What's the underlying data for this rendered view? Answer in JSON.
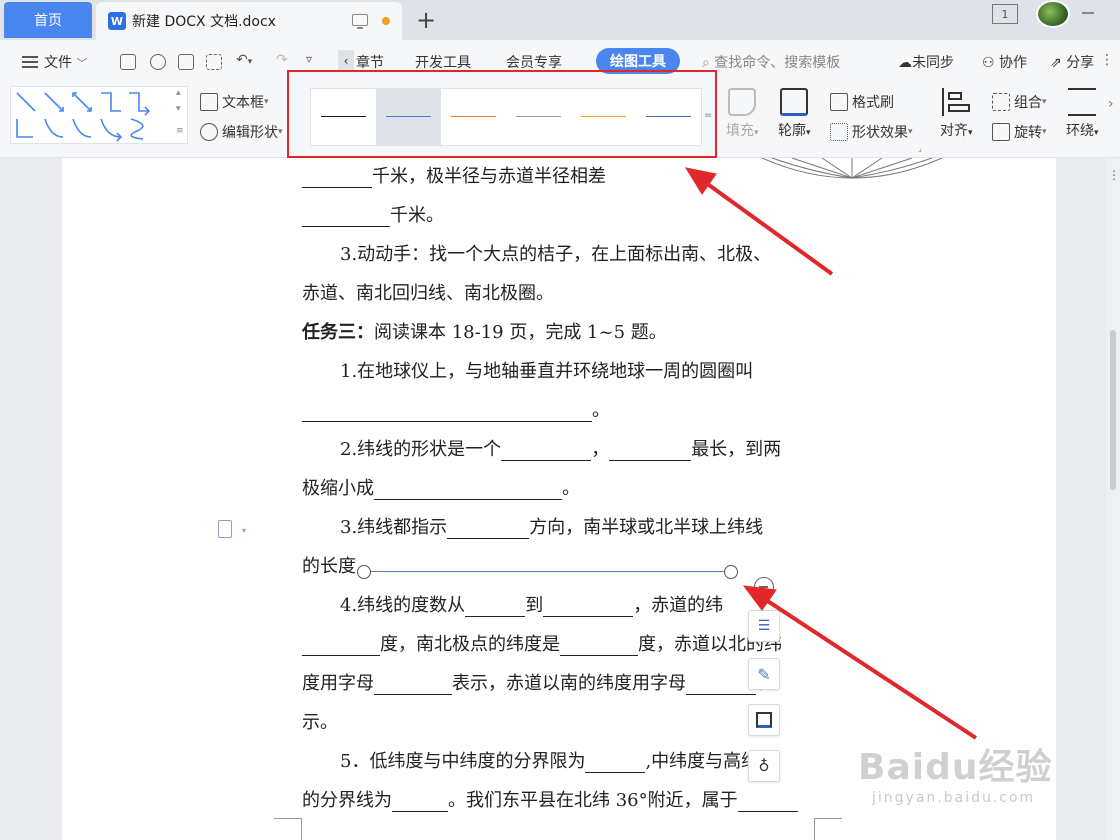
{
  "tabs": {
    "home": "首页",
    "document": "新建 DOCX 文档.docx",
    "page_count_badge": "1"
  },
  "menu": {
    "file": "文件",
    "chapter": "章节",
    "dev_tools": "开发工具",
    "member": "会员专享",
    "draw_tools": "绘图工具",
    "search_placeholder": "查找命令、搜索模板",
    "unsynced": "未同步",
    "collaborate": "协作",
    "share": "分享"
  },
  "toolbar": {
    "text_box": "文本框",
    "edit_shape": "编辑形状",
    "fill": "填充",
    "outline": "轮廓",
    "format_painter": "格式刷",
    "shape_effects": "形状效果",
    "align": "对齐",
    "group": "组合",
    "rotate": "旋转",
    "wrap": "环绕",
    "line_styles": [
      {
        "color": "#1a1a1a",
        "selected": false
      },
      {
        "color": "#4a7fc8",
        "selected": true
      },
      {
        "color": "#e07a30",
        "selected": false
      },
      {
        "color": "#9a9a9a",
        "selected": false
      },
      {
        "color": "#e8b020",
        "selected": false
      },
      {
        "color": "#4a6fb8",
        "selected": false
      }
    ]
  },
  "document": {
    "line1": "千米，极半径与赤道半径相差",
    "line2": "千米。",
    "line3": "3.动动手：找一个大点的桔子，在上面标出南、北极、",
    "line4": "赤道、南北回归线、南北极圈。",
    "line5_bold": "任务三：",
    "line5": "阅读课本 18-19 页，完成 1~5 题。",
    "line6": "1.在地球仪上，与地轴垂直并环绕地球一周的圆圈叫",
    "line7_end": "。",
    "line8a": "2.纬线的形状是一个",
    "line8b": "，",
    "line8c": "最长，到两",
    "line9a": "极缩小成",
    "line9b": "。",
    "line10a": "3.纬线都指示",
    "line10b": "方向，南半球或北半球上纬线",
    "line11": "的长度",
    "line12a": "4.纬线的度数从",
    "line12b": "到",
    "line12c": "，赤道的纬",
    "line13a": "度，南北极点的纬度是",
    "line13b": "度，赤道以北的纬",
    "line14a": "度用字母",
    "line14b": "表示，赤道以南的纬度用字母",
    "line14c": "表",
    "line15": "示。",
    "line16a": "5．低纬度与中纬度的分界限为",
    "line16b": ",中纬度与高纬度",
    "line17a": "的分界线为",
    "line17b": "。我们东平县在北纬 36°附近，属于"
  },
  "watermark": {
    "brand": "Baidu经验",
    "url": "jingyan.baidu.com"
  },
  "colors": {
    "accent": "#4a86f0",
    "annotation_red": "#e2272b",
    "drawn_line": "#5b84c4"
  }
}
